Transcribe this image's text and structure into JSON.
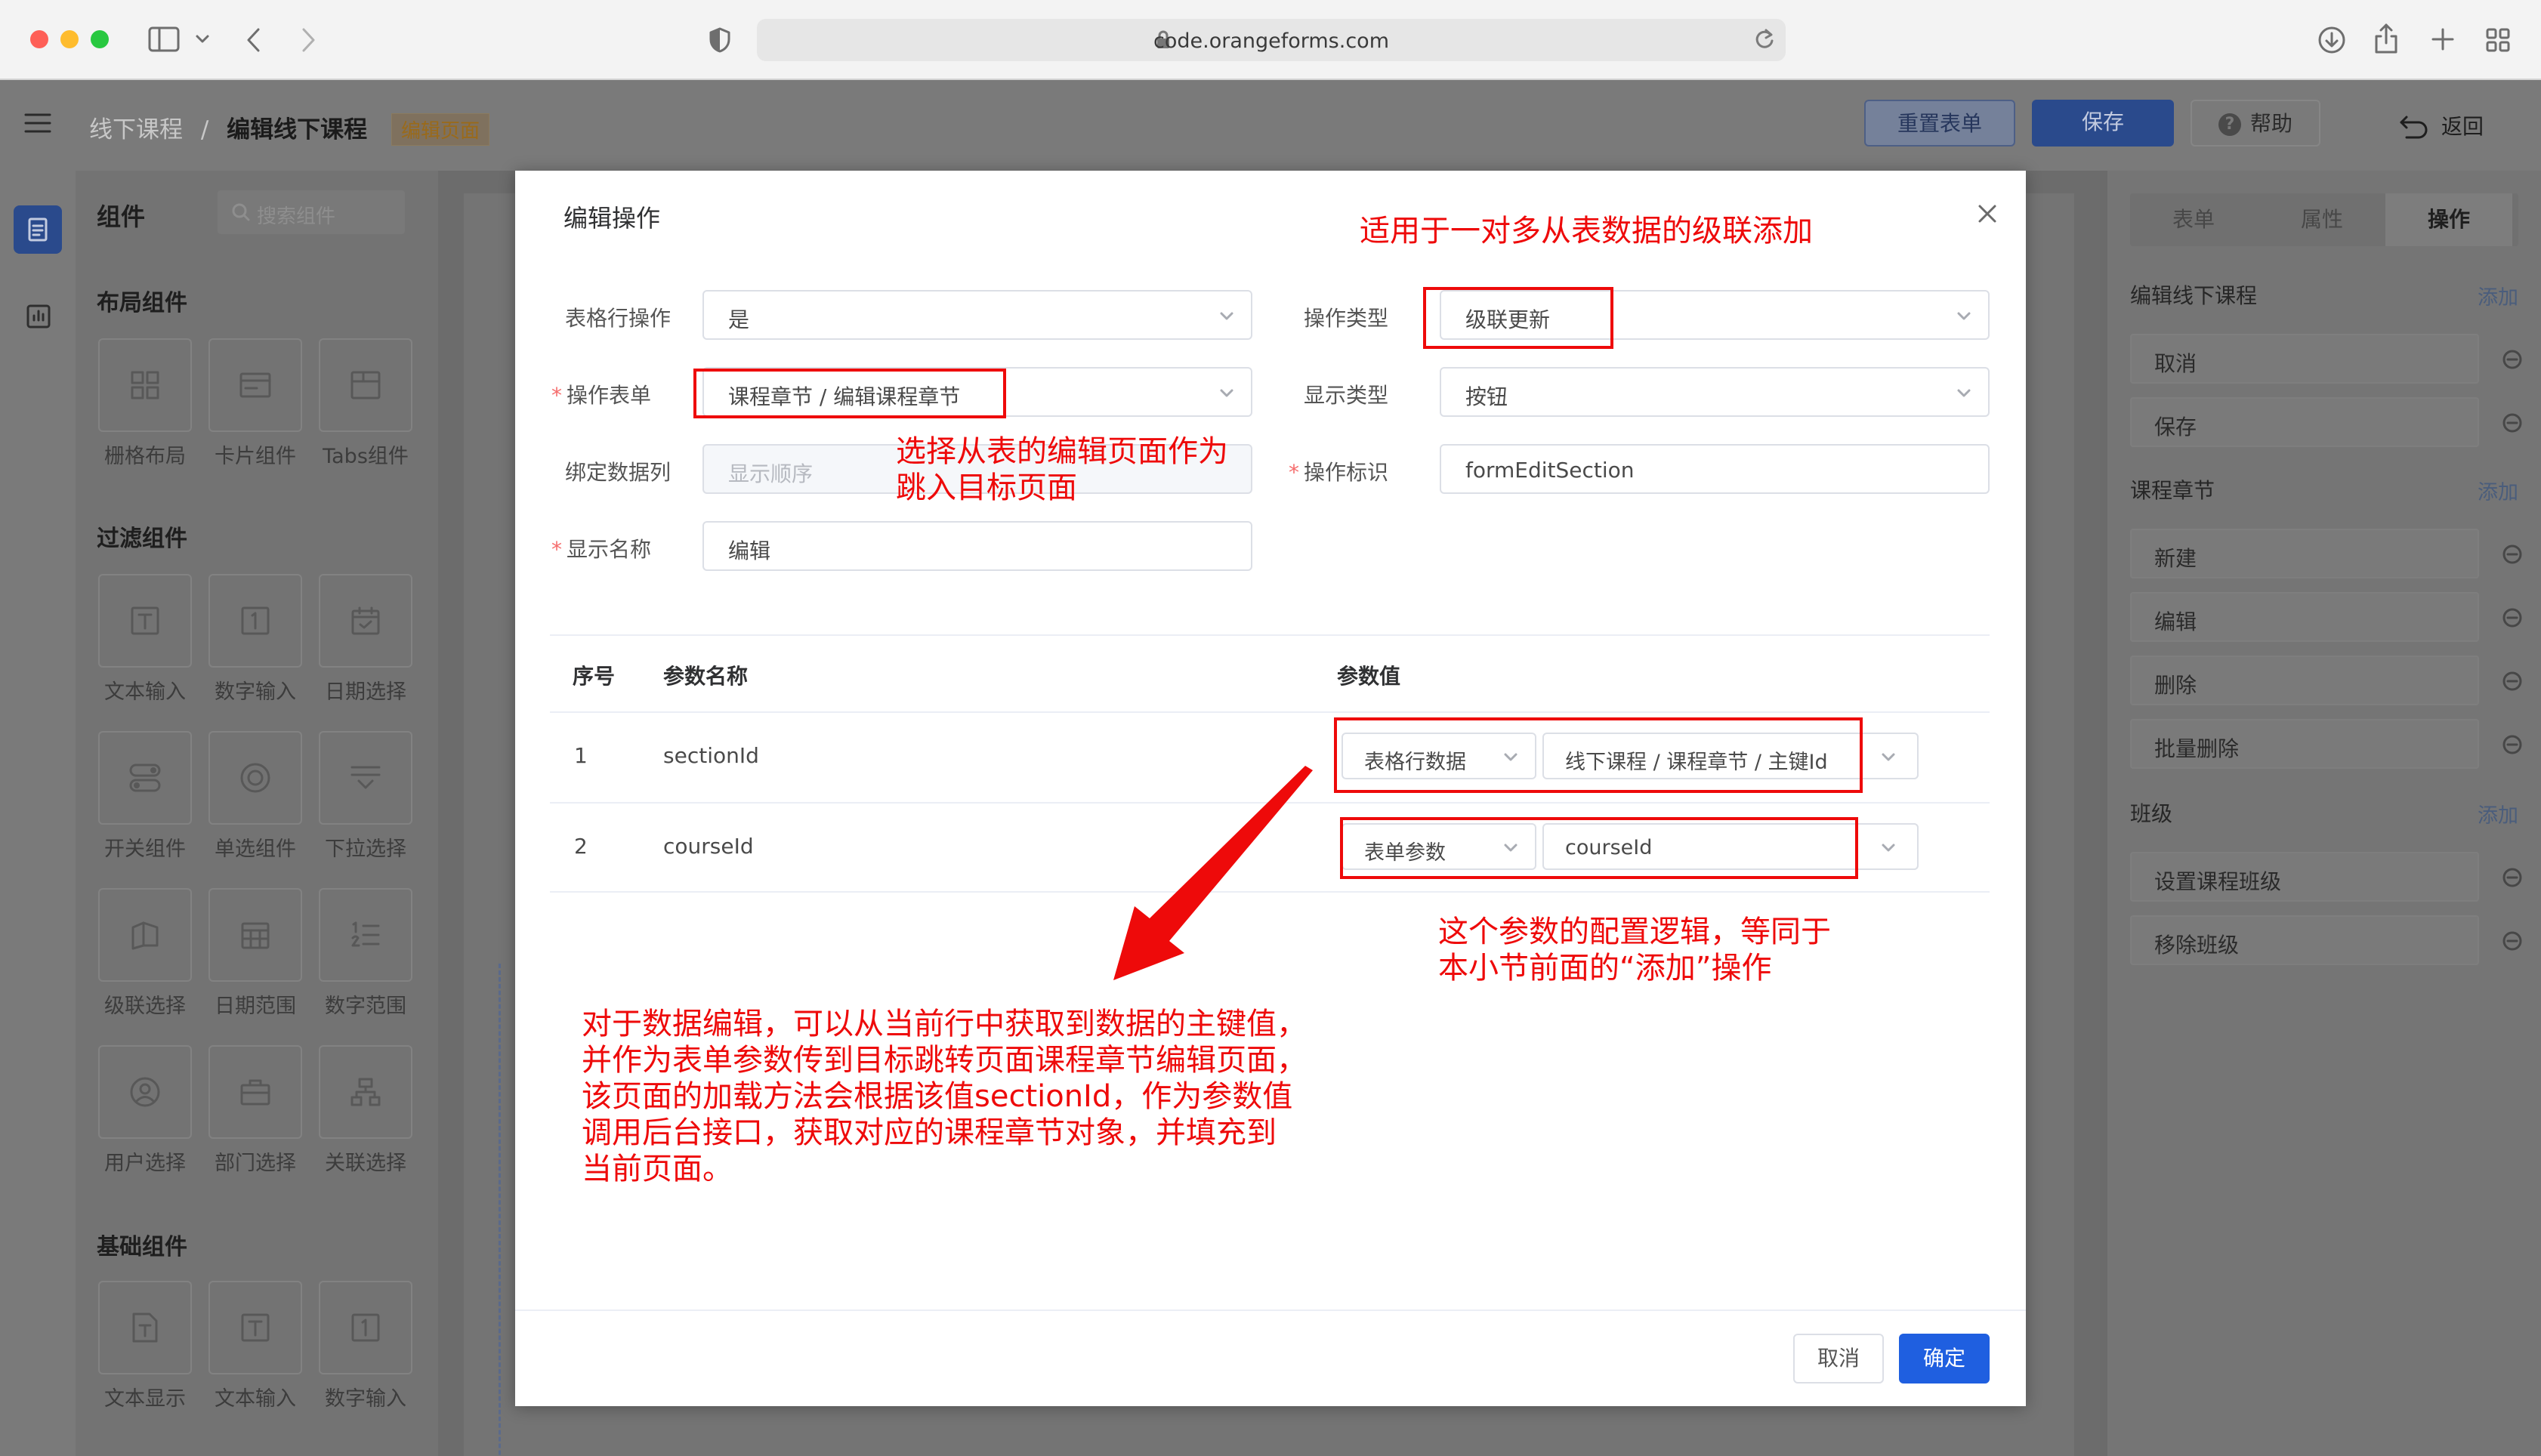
{
  "browser": {
    "url": "code.orangeforms.com"
  },
  "header": {
    "breadcrumb_parent": "线下课程",
    "breadcrumb_sep": "/",
    "breadcrumb_current": "编辑线下课程",
    "page_tag": "编辑页面",
    "reset_label": "重置表单",
    "save_label": "保存",
    "help_label": "帮助",
    "back_label": "返回"
  },
  "palette": {
    "title": "组件",
    "search_placeholder": "搜索组件",
    "sections": [
      {
        "title": "布局组件",
        "items": [
          {
            "label": "栅格布局",
            "icon": "grid-icon"
          },
          {
            "label": "卡片组件",
            "icon": "card-icon"
          },
          {
            "label": "Tabs组件",
            "icon": "tabs-icon"
          }
        ]
      },
      {
        "title": "过滤组件",
        "items": [
          {
            "label": "文本输入",
            "icon": "text-input-icon"
          },
          {
            "label": "数字输入",
            "icon": "number-input-icon"
          },
          {
            "label": "日期选择",
            "icon": "date-picker-icon"
          },
          {
            "label": "开关组件",
            "icon": "switch-icon"
          },
          {
            "label": "单选组件",
            "icon": "radio-icon"
          },
          {
            "label": "下拉选择",
            "icon": "dropdown-icon"
          },
          {
            "label": "级联选择",
            "icon": "cascader-icon"
          },
          {
            "label": "日期范围",
            "icon": "date-range-icon"
          },
          {
            "label": "数字范围",
            "icon": "number-range-icon"
          },
          {
            "label": "用户选择",
            "icon": "user-select-icon"
          },
          {
            "label": "部门选择",
            "icon": "dept-select-icon"
          },
          {
            "label": "关联选择",
            "icon": "relation-select-icon"
          }
        ]
      },
      {
        "title": "基础组件",
        "items": [
          {
            "label": "文本显示",
            "icon": "text-display-icon"
          },
          {
            "label": "文本输入",
            "icon": "text-input-icon"
          },
          {
            "label": "数字输入",
            "icon": "number-input-icon"
          }
        ]
      }
    ]
  },
  "right_panel": {
    "tabs": [
      "表单",
      "属性",
      "操作"
    ],
    "active_tab": "操作",
    "add_label": "添加",
    "groups": [
      {
        "title": "编辑线下课程",
        "items": [
          "取消",
          "保存"
        ]
      },
      {
        "title": "课程章节",
        "items": [
          "新建",
          "编辑",
          "删除",
          "批量删除"
        ]
      },
      {
        "title": "班级",
        "items": [
          "设置课程班级",
          "移除班级"
        ]
      }
    ]
  },
  "dialog": {
    "title": "编辑操作",
    "fields": {
      "row_op_label": "表格行操作",
      "row_op_value": "是",
      "op_type_label": "操作类型",
      "op_type_value": "级联更新",
      "op_form_label": "操作表单",
      "op_form_value": "课程章节 / 编辑课程章节",
      "display_type_label": "显示类型",
      "display_type_value": "按钮",
      "bind_col_label": "绑定数据列",
      "bind_col_placeholder": "显示顺序",
      "op_id_label": "操作标识",
      "op_id_value": "formEditSection",
      "display_name_label": "显示名称",
      "display_name_value": "编辑"
    },
    "table": {
      "headers": [
        "序号",
        "参数名称",
        "参数值"
      ],
      "rows": [
        {
          "no": "1",
          "name": "sectionId",
          "source": "表格行数据",
          "value": "线下课程 / 课程章节 / 主键Id"
        },
        {
          "no": "2",
          "name": "courseId",
          "source": "表单参数",
          "value": "courseId"
        }
      ]
    },
    "cancel_label": "取消",
    "confirm_label": "确定"
  },
  "annotations": {
    "top": "适用于一对多从表数据的级联添加",
    "select_line1": "选择从表的编辑页面作为",
    "select_line2": "跳入目标页面",
    "param_line1": "这个参数的配置逻辑，等同于",
    "param_line2": "本小节前面的“添加”操作",
    "edit_line1": "对于数据编辑，可以从当前行中获取到数据的主键值，",
    "edit_line2": "并作为表单参数传到目标跳转页面课程章节编辑页面，",
    "edit_line3": "该页面的加载方法会根据该值sectionId，作为参数值",
    "edit_line4": "调用后台接口，获取对应的课程章节对象，并填充到",
    "edit_line5": "当前页面。"
  },
  "colors": {
    "primary": "#1f5fe0",
    "annotation_red": "#ee0a0a"
  }
}
